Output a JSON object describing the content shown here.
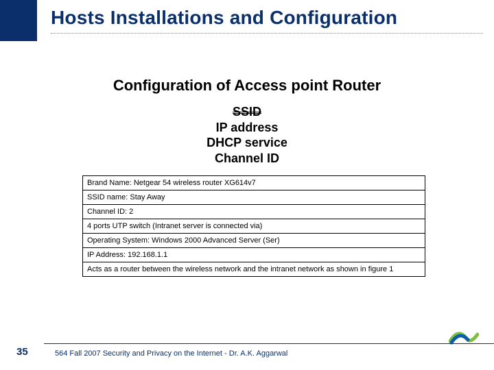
{
  "header": {
    "title": "Hosts Installations and Configuration"
  },
  "subtitle": "Configuration of Access point Router",
  "config": {
    "ssid": "SSID",
    "ip": "IP address",
    "dhcp": "DHCP service",
    "channel": "Channel ID"
  },
  "rows": [
    "Brand Name: Netgear 54 wireless router XG614v7",
    "SSID name: Stay Away",
    "Channel ID: 2",
    "4 ports UTP switch (Intranet server is connected via)",
    "Operating System: Windows 2000 Advanced Server (Ser)",
    "IP Address: 192.168.1.1",
    "Acts as a router between the wireless network and the intranet network as shown in figure 1"
  ],
  "footer": {
    "page": "35",
    "text": "564 Fall 2007 Security and Privacy on the Internet - Dr. A.K. Aggarwal"
  }
}
